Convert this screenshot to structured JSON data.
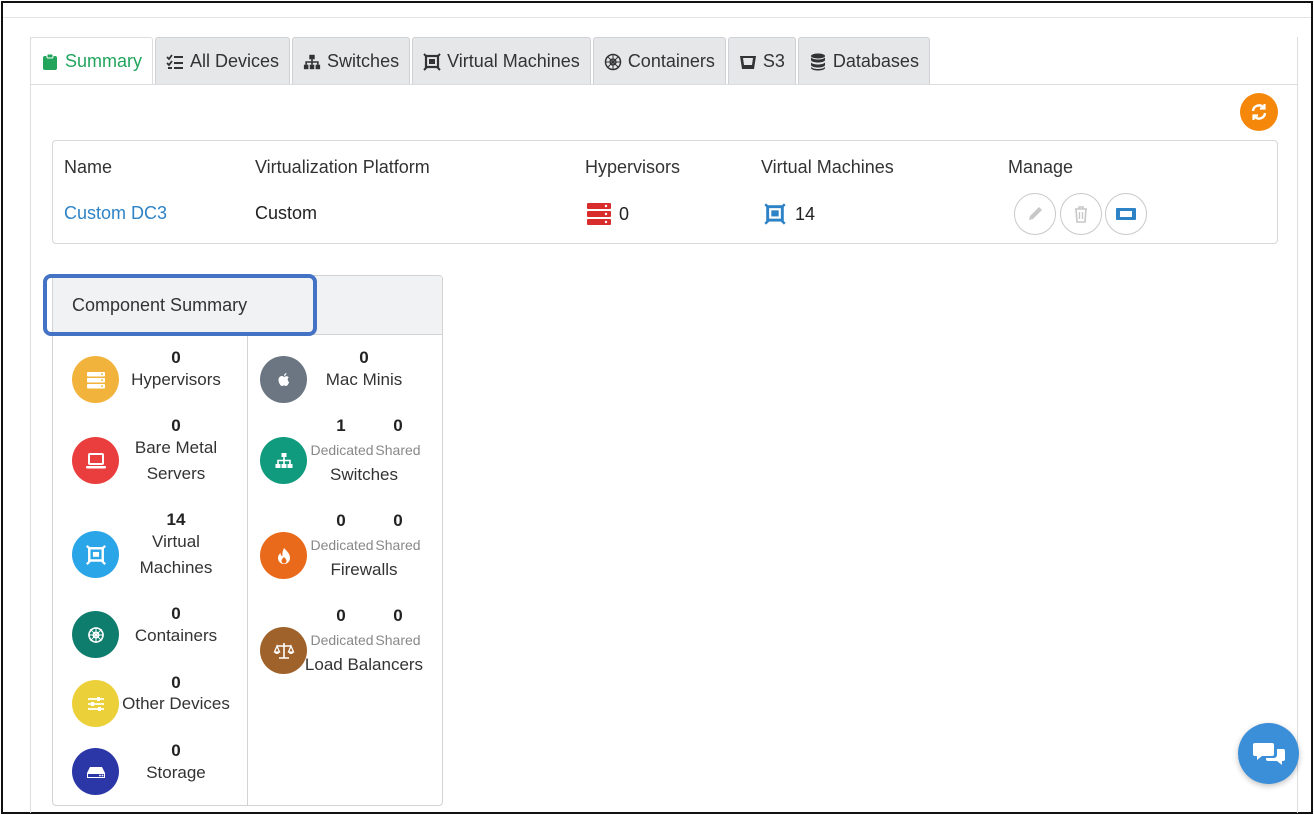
{
  "tabs": [
    {
      "label": "Summary",
      "icon": "clipboard-icon",
      "active": true
    },
    {
      "label": "All Devices",
      "icon": "list-check-icon"
    },
    {
      "label": "Switches",
      "icon": "sitemap-icon"
    },
    {
      "label": "Virtual Machines",
      "icon": "vm-icon"
    },
    {
      "label": "Containers",
      "icon": "helm-icon"
    },
    {
      "label": "S3",
      "icon": "bucket-icon"
    },
    {
      "label": "Databases",
      "icon": "database-icon"
    }
  ],
  "datacenter": {
    "headers": {
      "name": "Name",
      "platform": "Virtualization Platform",
      "hypervisors": "Hypervisors",
      "vms": "Virtual Machines",
      "manage": "Manage"
    },
    "row": {
      "name": "Custom DC3",
      "platform": "Custom",
      "hypervisors": "0",
      "vms": "14"
    }
  },
  "component_summary": {
    "title": "Component Summary",
    "left": [
      {
        "count": "0",
        "label": "Hypervisors",
        "icon": "server-icon",
        "color": "#f2b33d"
      },
      {
        "count": "0",
        "label1": "Bare Metal",
        "label2": "Servers",
        "icon": "laptop-icon",
        "color": "#ea3e3e"
      },
      {
        "count": "14",
        "label1": "Virtual",
        "label2": "Machines",
        "icon": "vm-icon",
        "color": "#2aa5e8"
      },
      {
        "count": "0",
        "label": "Containers",
        "icon": "helm-icon",
        "color": "#0f7d6e"
      },
      {
        "count": "0",
        "label": "Other Devices",
        "icon": "sliders-icon",
        "color": "#ecd03a"
      },
      {
        "count": "0",
        "label": "Storage",
        "icon": "hdd-icon",
        "color": "#2c37a7"
      }
    ],
    "right": {
      "mac": {
        "count": "0",
        "label": "Mac Minis",
        "icon": "apple-icon",
        "color": "#6b7682"
      },
      "switches": {
        "dedicated": "1",
        "shared": "0",
        "label": "Switches",
        "icon": "sitemap-icon",
        "color": "#109a7e"
      },
      "firewalls": {
        "dedicated": "0",
        "shared": "0",
        "label": "Firewalls",
        "icon": "fire-icon",
        "color": "#ea6a1c"
      },
      "lbs": {
        "dedicated": "0",
        "shared": "0",
        "label": "Load Balancers",
        "icon": "scale-icon",
        "color": "#a0622b"
      },
      "dedicated_label": "Dedicated",
      "shared_label": "Shared"
    }
  },
  "colors": {
    "accent_green": "#22a45d",
    "link": "#2e83c6",
    "refresh": "#f5870b",
    "chat": "#3a8fd8"
  }
}
